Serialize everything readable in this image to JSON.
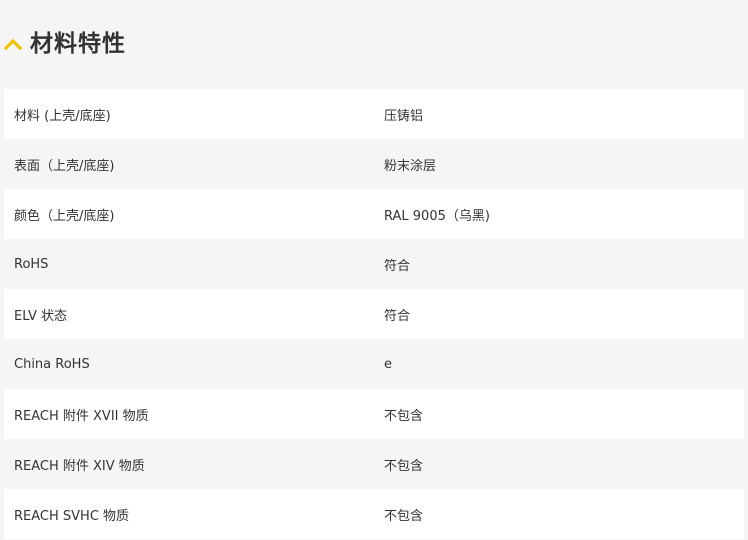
{
  "section": {
    "title": "材料特性",
    "icon": "chevron-up-icon",
    "accent_color": "#f2c200"
  },
  "specs": [
    {
      "label": "材料 (上壳/底座)",
      "value": "压铸铝"
    },
    {
      "label": "表面（上壳/底座)",
      "value": "粉末涂层"
    },
    {
      "label": "颜色（上壳/底座)",
      "value": "RAL 9005（乌黑)"
    },
    {
      "label": "RoHS",
      "value": "符合"
    },
    {
      "label": "ELV 状态",
      "value": "符合"
    },
    {
      "label": "China RoHS",
      "value": "e"
    },
    {
      "label": "REACH 附件 XVII 物质",
      "value": "不包含"
    },
    {
      "label": "REACH 附件 XIV 物质",
      "value": "不包含"
    },
    {
      "label": "REACH SVHC 物质",
      "value": "不包含"
    }
  ]
}
